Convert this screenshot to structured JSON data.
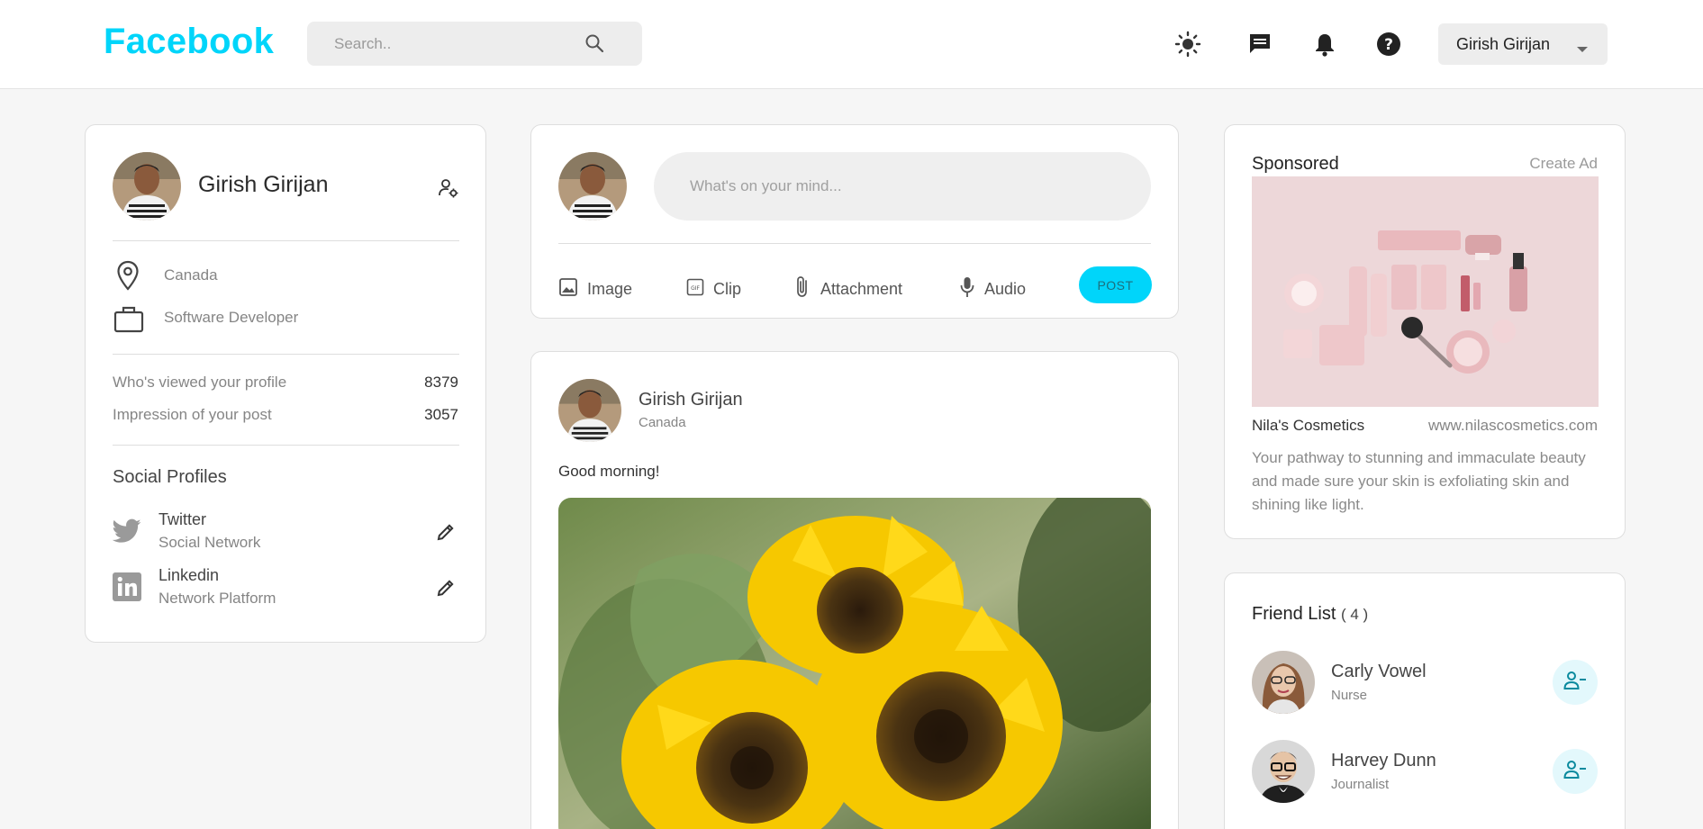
{
  "navbar": {
    "brand": "Facebook",
    "search_placeholder": "Search..",
    "user_name": "Girish Girijan"
  },
  "profile": {
    "name": "Girish Girijan",
    "location": "Canada",
    "occupation": "Software Developer",
    "stats": [
      {
        "label": "Who's viewed your profile",
        "value": "8379"
      },
      {
        "label": "Impression of your post",
        "value": "3057"
      }
    ],
    "social_title": "Social Profiles",
    "socials": [
      {
        "name": "Twitter",
        "sub": "Social Network"
      },
      {
        "name": "Linkedin",
        "sub": "Network Platform"
      }
    ]
  },
  "composer": {
    "placeholder": "What's on your mind...",
    "actions": {
      "image": "Image",
      "clip": "Clip",
      "attachment": "Attachment",
      "audio": "Audio"
    },
    "post_label": "POST"
  },
  "post": {
    "author": "Girish Girijan",
    "location": "Canada",
    "text": "Good morning!"
  },
  "sponsored": {
    "title": "Sponsored",
    "create_ad": "Create Ad",
    "company": "Nila's Cosmetics",
    "url": "www.nilascosmetics.com",
    "description": "Your pathway to stunning and immaculate beauty and made sure your skin is exfoliating skin and shining like light."
  },
  "friends": {
    "title": "Friend List",
    "count": "( 4 )",
    "items": [
      {
        "name": "Carly Vowel",
        "role": "Nurse"
      },
      {
        "name": "Harvey Dunn",
        "role": "Journalist"
      }
    ]
  },
  "colors": {
    "brand": "#00d5fa",
    "icon": "#2b2b2b",
    "muted": "#858585",
    "remove_bg": "#e3f8fc",
    "remove_icon": "#0a8a9e"
  }
}
